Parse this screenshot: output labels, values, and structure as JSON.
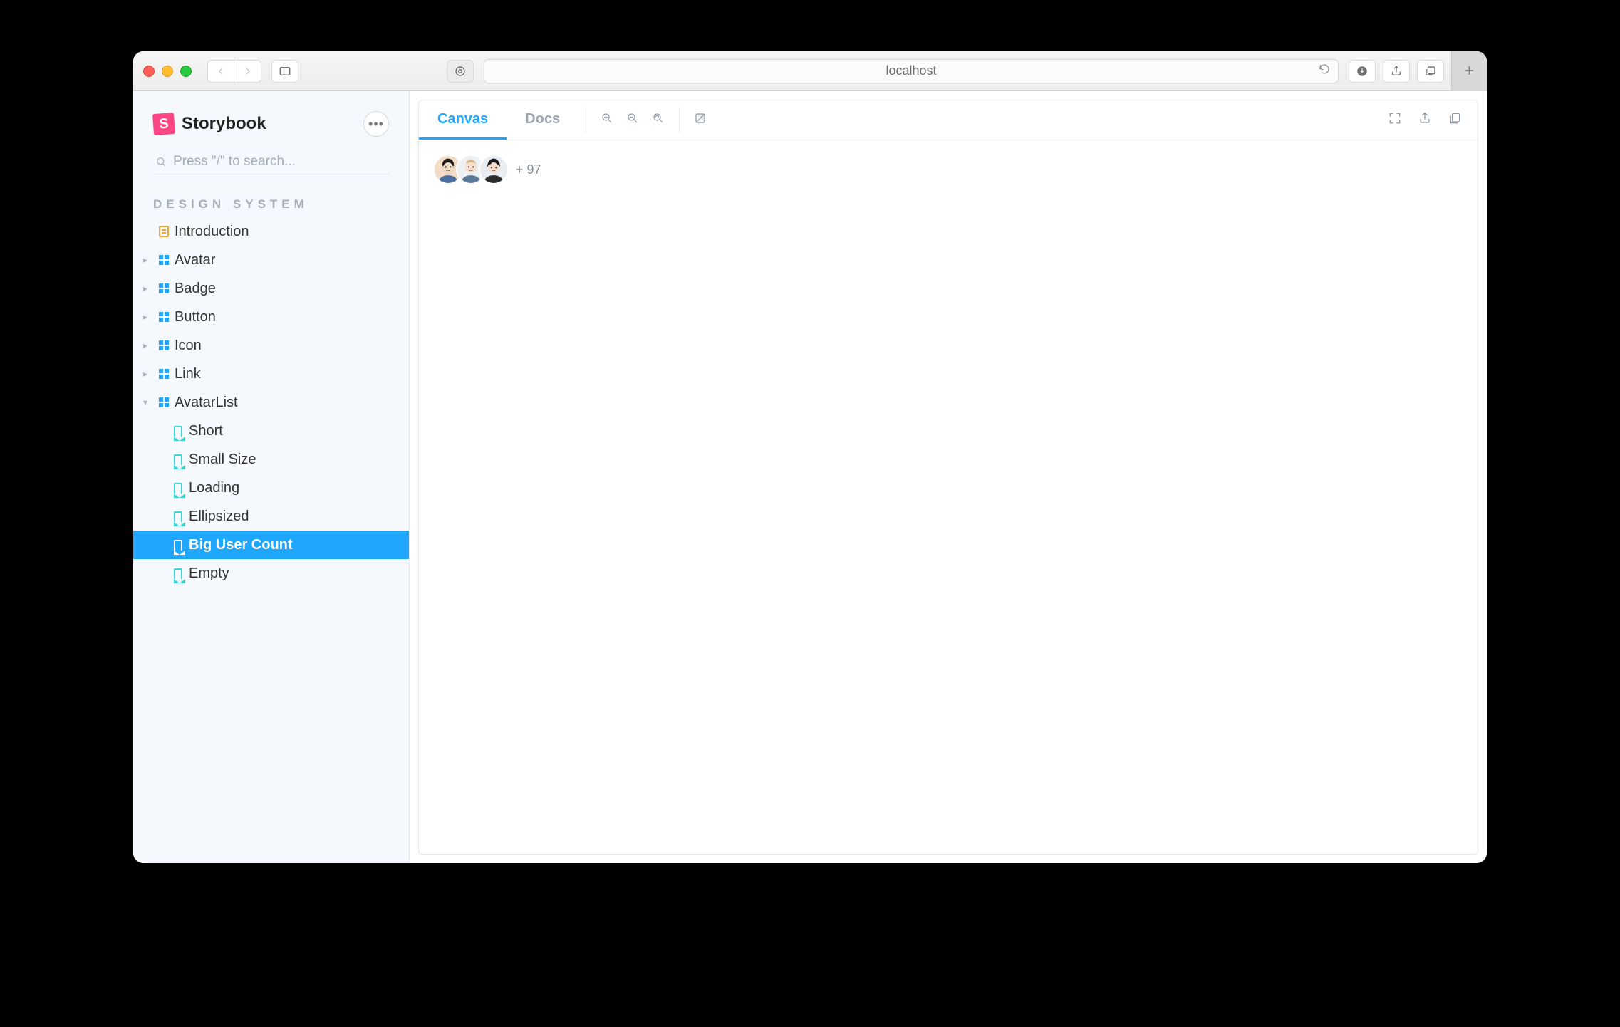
{
  "browser": {
    "url_display": "localhost"
  },
  "sidebar": {
    "brand": "Storybook",
    "search_placeholder": "Press \"/\" to search...",
    "section_title": "Design System",
    "items": [
      {
        "label": "Introduction",
        "kind": "doc",
        "expander": "none"
      },
      {
        "label": "Avatar",
        "kind": "component",
        "expander": "collapsed"
      },
      {
        "label": "Badge",
        "kind": "component",
        "expander": "collapsed"
      },
      {
        "label": "Button",
        "kind": "component",
        "expander": "collapsed"
      },
      {
        "label": "Icon",
        "kind": "component",
        "expander": "collapsed"
      },
      {
        "label": "Link",
        "kind": "component",
        "expander": "collapsed"
      },
      {
        "label": "AvatarList",
        "kind": "component",
        "expander": "expanded"
      }
    ],
    "stories": [
      {
        "label": "Short"
      },
      {
        "label": "Small Size"
      },
      {
        "label": "Loading"
      },
      {
        "label": "Ellipsized"
      },
      {
        "label": "Big User Count",
        "selected": true
      },
      {
        "label": "Empty"
      }
    ]
  },
  "main": {
    "tabs": {
      "canvas": "Canvas",
      "docs": "Docs"
    },
    "avatar_more": "+ 97"
  }
}
